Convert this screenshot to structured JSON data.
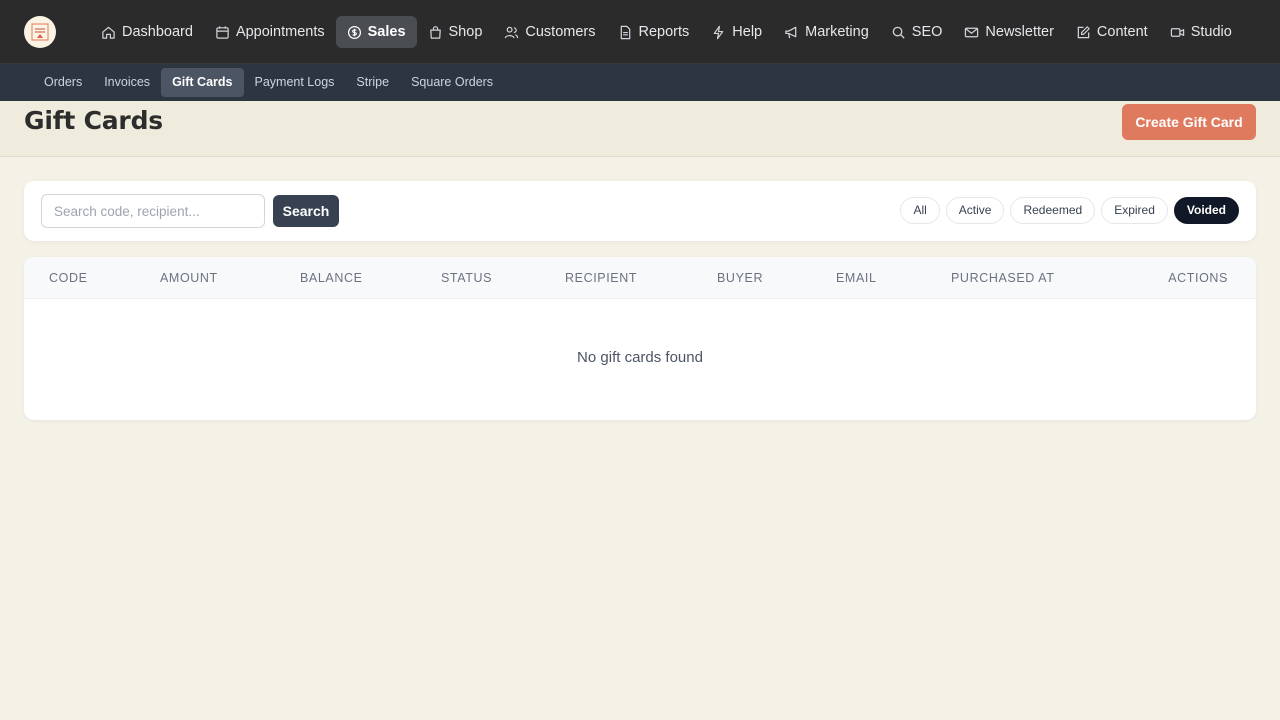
{
  "nav": {
    "items": [
      {
        "label": "Dashboard",
        "icon": "home-icon"
      },
      {
        "label": "Appointments",
        "icon": "calendar-icon"
      },
      {
        "label": "Sales",
        "icon": "dollar-icon",
        "active": true
      },
      {
        "label": "Shop",
        "icon": "shopping-bag-icon"
      },
      {
        "label": "Customers",
        "icon": "users-icon"
      },
      {
        "label": "Reports",
        "icon": "file-icon"
      },
      {
        "label": "Help",
        "icon": "bolt-icon"
      },
      {
        "label": "Marketing",
        "icon": "megaphone-icon"
      },
      {
        "label": "SEO",
        "icon": "search-icon"
      },
      {
        "label": "Newsletter",
        "icon": "mail-icon"
      },
      {
        "label": "Content",
        "icon": "edit-icon"
      },
      {
        "label": "Studio",
        "icon": "video-icon"
      }
    ]
  },
  "subnav": {
    "items": [
      {
        "label": "Orders"
      },
      {
        "label": "Invoices"
      },
      {
        "label": "Gift Cards",
        "active": true
      },
      {
        "label": "Payment Logs"
      },
      {
        "label": "Stripe"
      },
      {
        "label": "Square Orders"
      }
    ]
  },
  "page": {
    "title": "Gift Cards",
    "create_label": "Create Gift Card"
  },
  "filters": {
    "search_placeholder": "Search code, recipient...",
    "search_label": "Search",
    "status_options": [
      "All",
      "Active",
      "Redeemed",
      "Expired",
      "Voided"
    ],
    "selected_status": "Voided"
  },
  "table": {
    "columns": [
      "CODE",
      "AMOUNT",
      "BALANCE",
      "STATUS",
      "RECIPIENT",
      "BUYER",
      "EMAIL",
      "PURCHASED AT",
      "ACTIONS"
    ],
    "rows": [],
    "empty_message": "No gift cards found"
  },
  "colors": {
    "accent": "#e07a5f",
    "topnav_bg": "#2b2b2b",
    "subnav_bg": "#2c3540",
    "page_bg": "#f4f1e6",
    "selected_pill": "#111827"
  }
}
